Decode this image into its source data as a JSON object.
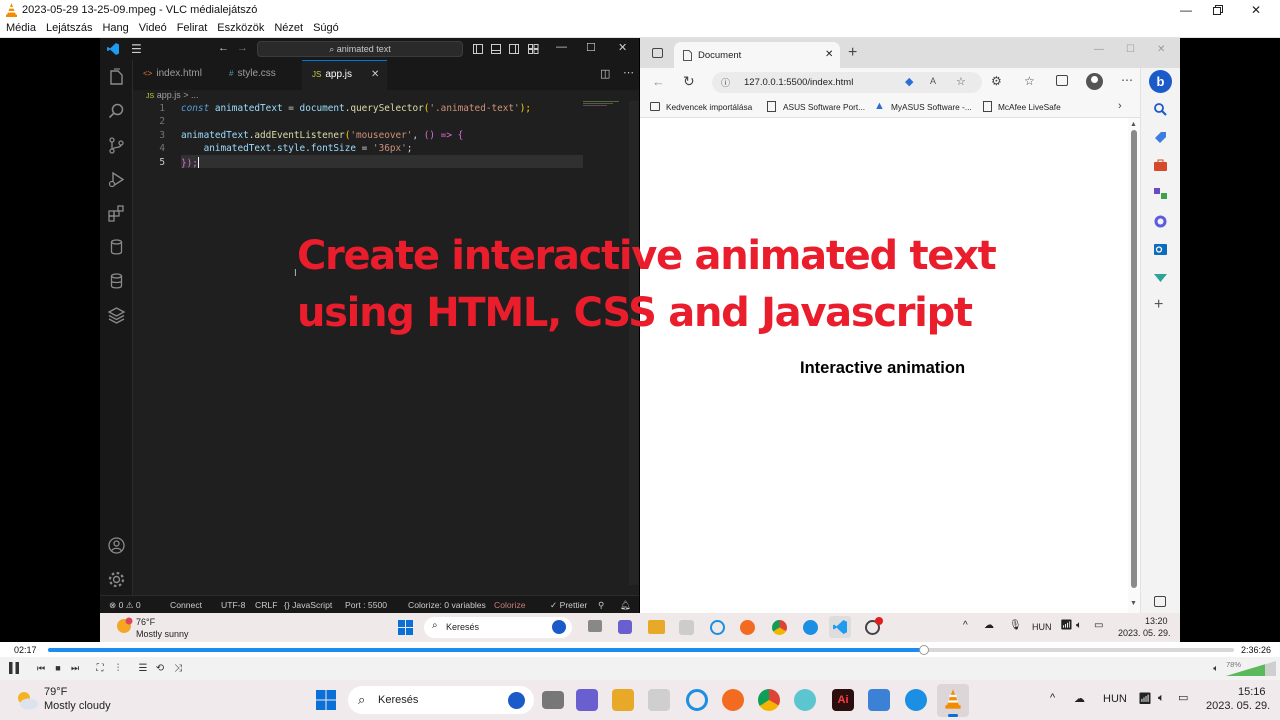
{
  "vlc": {
    "title": "2023-05-29 13-25-09.mpeg - VLC médialejátszó",
    "menu": [
      "Média",
      "Lejátszás",
      "Hang",
      "Videó",
      "Felirat",
      "Eszközök",
      "Nézet",
      "Súgó"
    ],
    "time_elapsed": "02:17",
    "time_total": "2:36:26",
    "progress": 0.739,
    "volume": "78%",
    "volume_level": 0.78
  },
  "vscode": {
    "search_text": "animated text",
    "tabs": [
      {
        "label": "index.html",
        "icon": "<>",
        "icon_color": "#e37933"
      },
      {
        "label": "style.css",
        "icon": "#",
        "icon_color": "#519aba"
      },
      {
        "label": "app.js",
        "icon": "JS",
        "icon_color": "#cbcb41"
      }
    ],
    "active_tab": "app.js",
    "breadcrumb_file": "app.js",
    "breadcrumb_rest": "> ...",
    "line_numbers": [
      "1",
      "2",
      "3",
      "4",
      "5"
    ],
    "code": {
      "l1_kw": "const",
      "l1_var": " animatedText",
      "l1_op": " = ",
      "l1_obj": "document",
      "l1_dot": ".",
      "l1_fn": "querySelector",
      "l1_p1": "(",
      "l1_str": "'.animated-text'",
      "l1_p2": ");",
      "l3_var": "animatedText",
      "l3_dot": ".",
      "l3_fn": "addEventListener",
      "l3_p1": "(",
      "l3_str": "'mouseover'",
      "l3_mid": ", ",
      "l3_arrow": "() => {",
      "l4_indent": "    ",
      "l4_a": "animatedText",
      "l4_b": ".style.",
      "l4_c": "fontSize",
      "l4_op": " = ",
      "l4_str": "'36px'",
      "l4_end": ";",
      "l5_close": "});"
    },
    "status": {
      "errors": "⊗ 0 ⚠ 0",
      "connect": "Connect",
      "encoding": "UTF-8",
      "eol": "CRLF",
      "language": "{} JavaScript",
      "port": "Port : 5500",
      "colorize_vars": "Colorize: 0 variables",
      "colorize": "Colorize",
      "prettier": "✓ Prettier"
    }
  },
  "browser": {
    "tab_title": "Document",
    "url": "127.0.0.1:5500/index.html",
    "bookmarks": [
      "Kedvencek importálása",
      "ASUS Software Port...",
      "MyASUS Software -...",
      "McAfee LiveSafe"
    ],
    "page_heading": "Interactive animation"
  },
  "overlay": {
    "line1": "Create interactive animated text",
    "line2": "using HTML, CSS and Javascript"
  },
  "inner_taskbar": {
    "weather_temp": "76°F",
    "weather_desc": "Mostly sunny",
    "search": "Keresés",
    "lang": "HUN",
    "time": "13:20",
    "date": "2023. 05. 29."
  },
  "taskbar": {
    "weather_temp": "79°F",
    "weather_desc": "Mostly cloudy",
    "search": "Keresés",
    "lang": "HUN",
    "time": "15:16",
    "date": "2023. 05. 29."
  },
  "colors": {
    "overlay_red": "#ea1d2c",
    "vscode_bg": "#1f1f1f",
    "vlc_progress": "#1d8cf0",
    "vlc_cone": "#f28c00"
  }
}
